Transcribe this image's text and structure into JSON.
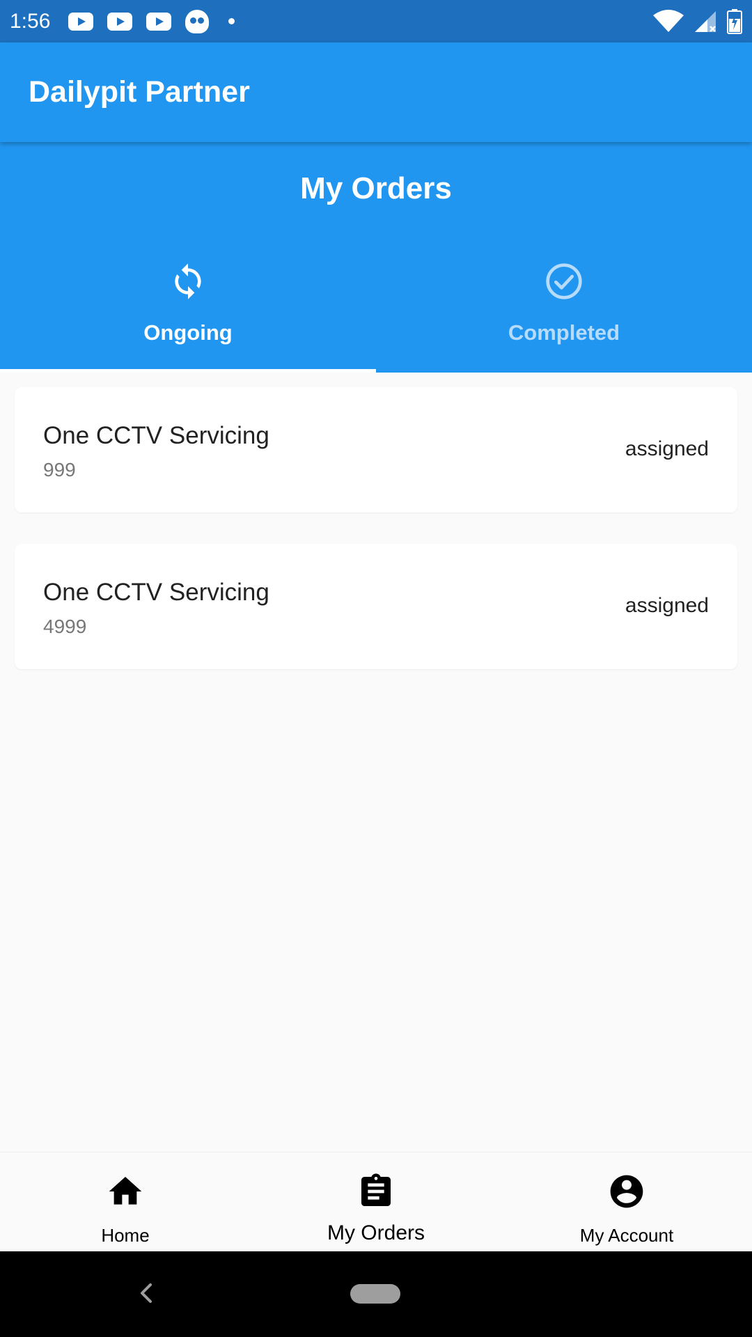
{
  "status_bar": {
    "time": "1:56",
    "left_icons": [
      "youtube-icon",
      "youtube-icon",
      "youtube-icon",
      "skull-icon",
      "dot-icon"
    ],
    "right_icons": [
      "wifi-icon",
      "signal-icon",
      "battery-icon"
    ]
  },
  "app_bar": {
    "title": "Dailypit Partner"
  },
  "page": {
    "title": "My Orders",
    "tabs": [
      {
        "label": "Ongoing",
        "icon": "refresh-icon",
        "selected": true
      },
      {
        "label": "Completed",
        "icon": "check-circle-icon",
        "selected": false
      }
    ]
  },
  "orders": [
    {
      "title": "One CCTV Servicing",
      "price": "999",
      "status": "assigned"
    },
    {
      "title": "One CCTV Servicing",
      "price": "4999",
      "status": "assigned"
    }
  ],
  "bottom_nav": {
    "items": [
      {
        "label": "Home",
        "icon": "home-icon"
      },
      {
        "label": "My Orders",
        "icon": "clipboard-icon",
        "selected": true
      },
      {
        "label": "My Account",
        "icon": "account-circle-icon"
      }
    ]
  },
  "colors": {
    "primary": "#2196f0",
    "status_bar": "#1e6fbd",
    "tab_unselected": "#b7dcfb",
    "background": "#fafafa"
  }
}
